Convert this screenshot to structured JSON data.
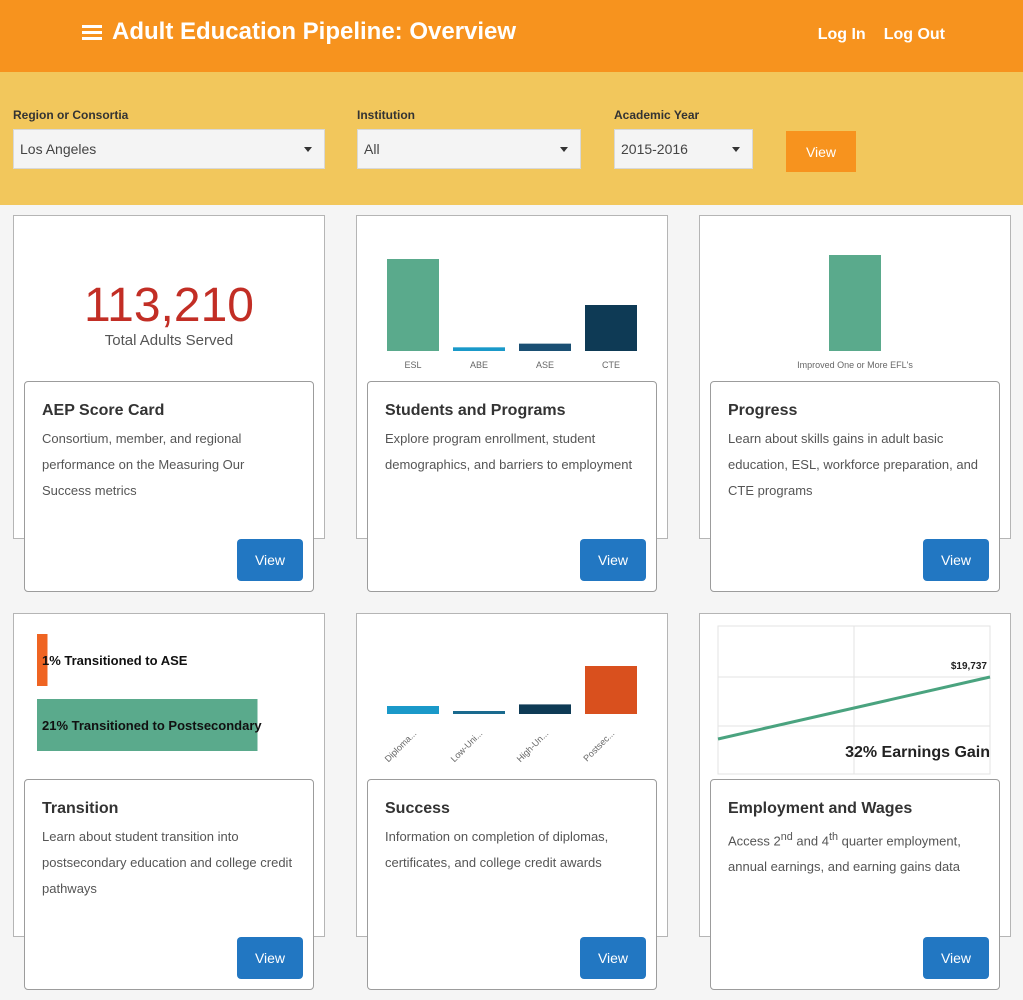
{
  "header": {
    "title": "Adult Education Pipeline: Overview",
    "login": "Log In",
    "logout": "Log Out"
  },
  "filters": {
    "region": {
      "label": "Region or Consortia",
      "value": "Los Angeles"
    },
    "institution": {
      "label": "Institution",
      "value": "All"
    },
    "year": {
      "label": "Academic Year",
      "value": "2015-2016"
    },
    "view_label": "View"
  },
  "cards": [
    {
      "title": "AEP Score Card",
      "desc": "Consortium, member, and regional performance on the Measuring Our Success metrics",
      "button": "View",
      "stat_value": "113,210",
      "stat_label": "Total Adults Served"
    },
    {
      "title": "Students and Programs",
      "desc": "Explore program enrollment, student demographics, and barriers to employment",
      "button": "View"
    },
    {
      "title": "Progress",
      "desc": "Learn about skills gains in adult basic education, ESL, workforce preparation, and CTE programs",
      "button": "View"
    },
    {
      "title": "Transition",
      "desc": "Learn about student transition into postsecondary education and college credit pathways",
      "button": "View"
    },
    {
      "title": "Success",
      "desc": "Information on completion of diplomas, certificates, and college credit awards",
      "button": "View"
    },
    {
      "title": "Employment and Wages",
      "desc_parts": [
        "Access 2",
        "nd",
        " and 4",
        "th",
        " quarter employment, annual earnings, and earning gains data"
      ],
      "button": "View"
    }
  ],
  "chart_data": [
    {
      "type": "bar",
      "categories": [
        "ESL",
        "ABE",
        "ASE",
        "CTE"
      ],
      "values": [
        100,
        4,
        8,
        50
      ],
      "colors": [
        "#5aaa8c",
        "#1a99c9",
        "#1a4f73",
        "#0e3a55"
      ]
    },
    {
      "type": "bar",
      "categories": [
        "Improved One or More EFL's"
      ],
      "values": [
        100
      ],
      "colors": [
        "#5aaa8c"
      ]
    },
    {
      "type": "bar",
      "orientation": "horizontal",
      "categories": [
        "1% Transitioned to ASE",
        "21% Transitioned to Postsecondary"
      ],
      "values": [
        1,
        21
      ],
      "colors": [
        "#ef6422",
        "#5aaa8c"
      ]
    },
    {
      "type": "bar",
      "categories": [
        "Diploma...",
        "Low-Uni...",
        "High-Un...",
        "Postsec..."
      ],
      "values": [
        10,
        3,
        12,
        60
      ],
      "colors": [
        "#1a99c9",
        "#1a6a8e",
        "#0e3a55",
        "#d9501e"
      ]
    },
    {
      "type": "line",
      "x": [
        0,
        1
      ],
      "y": [
        0,
        19737
      ],
      "end_label": "$19,737",
      "annotation": "32% Earnings Gain",
      "color": "#4aa37f"
    }
  ]
}
